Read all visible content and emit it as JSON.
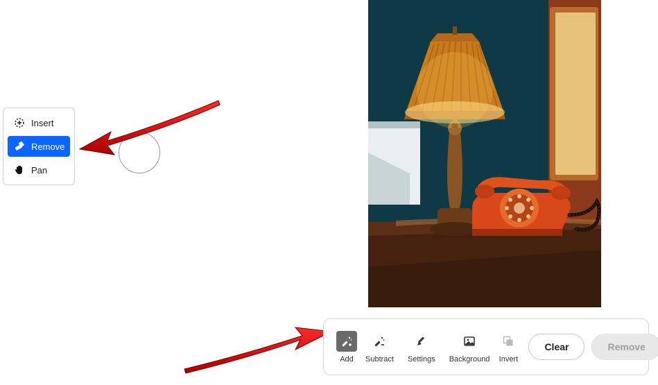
{
  "side_panel": {
    "insert_label": "Insert",
    "remove_label": "Remove",
    "pan_label": "Pan"
  },
  "bottom_toolbar": {
    "add_label": "Add",
    "subtract_label": "Subtract",
    "settings_label": "Settings",
    "background_label": "Background",
    "invert_label": "Invert",
    "clear_label": "Clear",
    "remove_label": "Remove"
  }
}
